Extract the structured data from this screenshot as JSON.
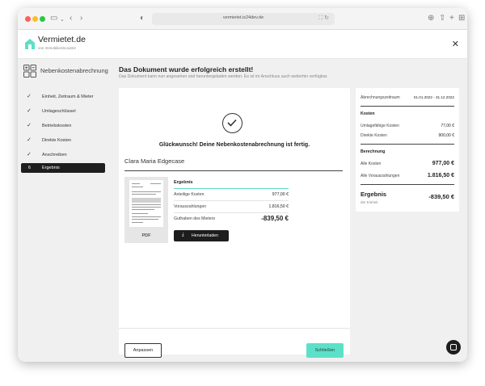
{
  "browser": {
    "url": "vermietet.is24dev.de",
    "tab_icons": [
      "sidebar-icon",
      "back-icon",
      "forward-icon",
      "shield-icon",
      "download-icon",
      "share-icon",
      "new-tab-icon",
      "tabs-overview-icon"
    ]
  },
  "header": {
    "brand": "Vermietet.de",
    "brand_sub": "von ImmobilienScout24"
  },
  "section_title": "Nebenkostenabrechnung",
  "main": {
    "title": "Das Dokument wurde erfolgreich erstellt!",
    "subtitle": "Das Dokument kann nun angesehen und heruntergeladen werden. Es ist im Anschluss auch weiterhin verfügbar."
  },
  "steps": [
    {
      "label": "Einheit, Zeitraum & Mieter",
      "marker": "✓",
      "active": false
    },
    {
      "label": "Umlageschlüssel",
      "marker": "✓",
      "active": false
    },
    {
      "label": "Betriebskosten",
      "marker": "✓",
      "active": false
    },
    {
      "label": "Direkte Kosten",
      "marker": "✓",
      "active": false
    },
    {
      "label": "Anschreiben",
      "marker": "✓",
      "active": false
    },
    {
      "label": "Ergebnis",
      "marker": "6",
      "active": true
    }
  ],
  "card": {
    "congrats": "Glückwunsch! Deine Nebenkostenabrechnung ist fertig.",
    "tenant": "Clara Maria Edgecase",
    "pdf_label": "PDF",
    "result_title": "Ergebnis",
    "rows": [
      {
        "label": "Anteilige Kosten",
        "value": "977,00 €"
      },
      {
        "label": "Vorauszahlungen",
        "value": "1.816,50 €"
      }
    ],
    "total": {
      "label": "Guthaben des Mieters",
      "value": "-839,50 €"
    },
    "download_label": "Herunterladen",
    "btn_adjust": "Anpassen",
    "btn_close": "Schließen"
  },
  "summary": {
    "period_label": "Abrechnungszeitraum",
    "period_value": "01.01.2022 - 31.12.2022",
    "kosten_head": "Kosten",
    "umlage_label": "Umlagefähige Kosten",
    "umlage_value": "77,00 €",
    "direkt_label": "Direkte Kosten",
    "direkt_value": "900,00 €",
    "berechnung_head": "Berechnung",
    "alle_kosten_label": "Alle Kosten",
    "alle_kosten_value": "977,00 €",
    "alle_vz_label": "Alle Vorauszahlungen",
    "alle_vz_value": "1.816,50 €",
    "ergebnis_label": "Ergebnis",
    "ergebnis_sub": "der Einheit",
    "ergebnis_value": "-839,50 €"
  },
  "colors": {
    "accent": "#5ce0c8",
    "dark": "#1e1e1e",
    "background": "#f0f0f0"
  }
}
